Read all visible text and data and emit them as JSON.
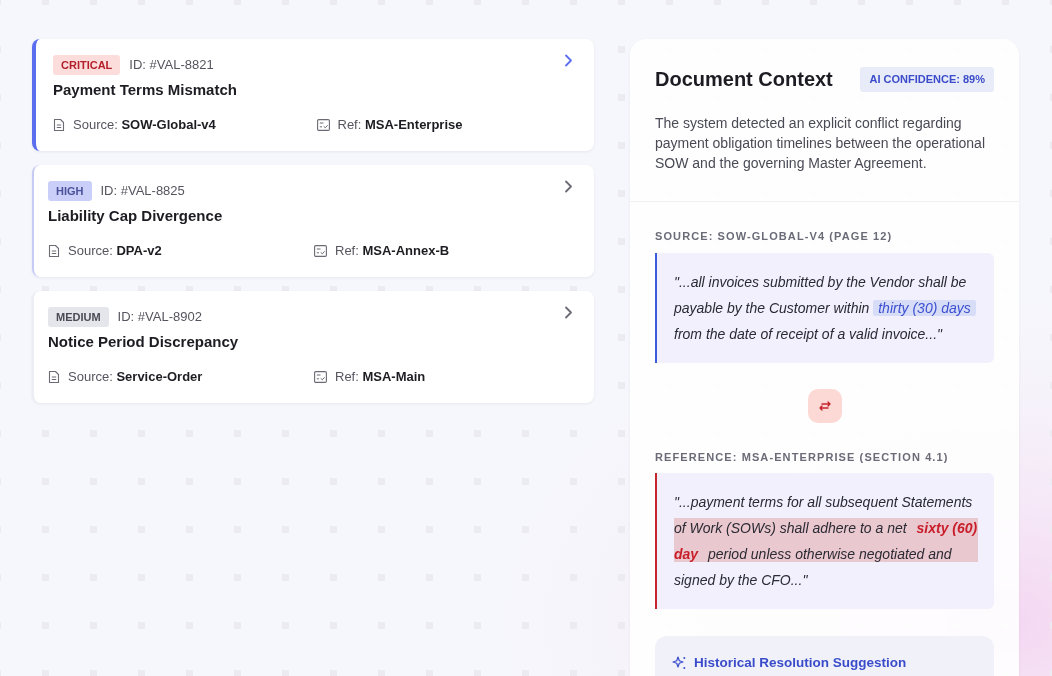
{
  "issues": [
    {
      "kind": "critical",
      "badge": "CRITICAL",
      "id": "ID: #VAL-8821",
      "title": "Payment Terms Mismatch",
      "source_label": "Source:",
      "source": "SOW-Global-v4",
      "ref_label": "Ref:",
      "ref": "MSA-Enterprise",
      "selected": true
    },
    {
      "kind": "high",
      "badge": "HIGH",
      "id": "ID: #VAL-8825",
      "title": "Liability Cap Divergence",
      "source_label": "Source:",
      "source": "DPA-v2",
      "ref_label": "Ref:",
      "ref": "MSA-Annex-B",
      "selected": false
    },
    {
      "kind": "medium",
      "badge": "MEDIUM",
      "id": "ID: #VAL-8902",
      "title": "Notice Period Discrepancy",
      "source_label": "Source:",
      "source": "Service-Order",
      "ref_label": "Ref:",
      "ref": "MSA-Main",
      "selected": false
    }
  ],
  "context_panel": {
    "title": "Document Context",
    "confidence": "AI CONFIDENCE: 89%",
    "summary": "The system detected an explicit conflict regarding payment obligation timelines between the operational SOW and the governing Master Agreement.",
    "excerpts": [
      {
        "kind": "source",
        "label": "SOURCE: SOW-GLOBAL-V4 (PAGE 12)",
        "before": "\"...all invoices submitted by the Vendor shall be payable by the Customer within ",
        "highlight": "thirty (30) days",
        "after": " from the date of receipt of a valid invoice...\""
      },
      {
        "kind": "reference",
        "label": "REFERENCE: MSA-ENTERPRISE (SECTION 4.1)",
        "before": "\"...payment terms for all subsequent Statements of Work (SOWs) shall adhere to a net ",
        "highlight": "sixty (60) day",
        "after": " period unless otherwise negotiated and signed by the CFO...\""
      }
    ],
    "suggestion": {
      "title": "Historical Resolution Suggestion"
    }
  }
}
